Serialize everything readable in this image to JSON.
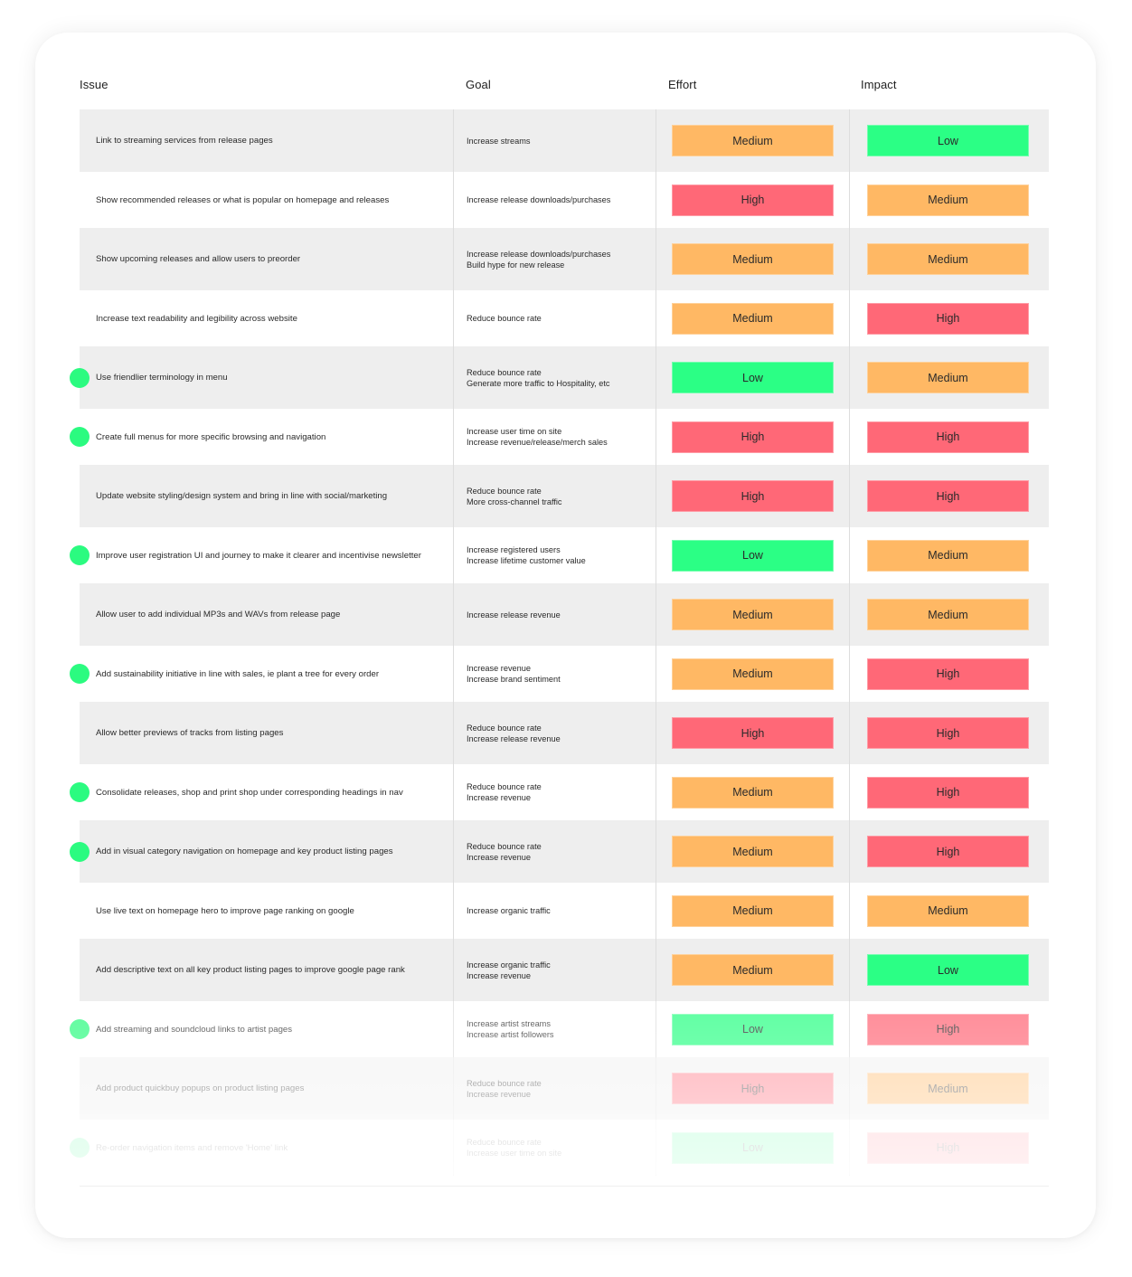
{
  "headers": {
    "issue": "Issue",
    "goal": "Goal",
    "effort": "Effort",
    "impact": "Impact"
  },
  "colors": {
    "Low": "#2bff85",
    "Medium": "#ffb864",
    "High": "#ff6877",
    "row_alt": "#eeeeee",
    "marker": "#2bfb80"
  },
  "rows": [
    {
      "issue": "Link to streaming services from release pages",
      "goal": [
        "Increase streams"
      ],
      "effort": "Medium",
      "impact": "Low",
      "marked": false
    },
    {
      "issue": "Show recommended releases or what is popular on homepage and releases",
      "goal": [
        "Increase release downloads/purchases"
      ],
      "effort": "High",
      "impact": "Medium",
      "marked": false
    },
    {
      "issue": "Show upcoming releases and allow users to preorder",
      "goal": [
        "Increase release downloads/purchases",
        "Build hype for new release"
      ],
      "effort": "Medium",
      "impact": "Medium",
      "marked": false
    },
    {
      "issue": "Increase text readability and legibility across website",
      "goal": [
        "Reduce bounce rate"
      ],
      "effort": "Medium",
      "impact": "High",
      "marked": false
    },
    {
      "issue": "Use friendlier terminology in menu",
      "goal": [
        "Reduce bounce rate",
        "Generate more traffic to Hospitality, etc"
      ],
      "effort": "Low",
      "impact": "Medium",
      "marked": true
    },
    {
      "issue": "Create full menus for more specific browsing and navigation",
      "goal": [
        "Increase user time on site",
        "Increase revenue/release/merch sales"
      ],
      "effort": "High",
      "impact": "High",
      "marked": true
    },
    {
      "issue": "Update website styling/design system and bring in line with social/marketing",
      "goal": [
        "Reduce bounce rate",
        "More cross-channel traffic"
      ],
      "effort": "High",
      "impact": "High",
      "marked": false
    },
    {
      "issue": "Improve user registration UI and journey to make it clearer and incentivise newsletter",
      "goal": [
        "Increase registered users",
        "Increase lifetime customer value"
      ],
      "effort": "Low",
      "impact": "Medium",
      "marked": true
    },
    {
      "issue": "Allow user to add individual MP3s and WAVs from release page",
      "goal": [
        "Increase release revenue"
      ],
      "effort": "Medium",
      "impact": "Medium",
      "marked": false
    },
    {
      "issue": "Add sustainability initiative in line with sales, ie plant a tree for every order",
      "goal": [
        "Increase revenue",
        "Increase brand sentiment"
      ],
      "effort": "Medium",
      "impact": "High",
      "marked": true
    },
    {
      "issue": "Allow better previews of tracks from listing pages",
      "goal": [
        "Reduce bounce rate",
        "Increase release revenue"
      ],
      "effort": "High",
      "impact": "High",
      "marked": false
    },
    {
      "issue": "Consolidate releases, shop and print shop under corresponding headings in nav",
      "goal": [
        "Reduce bounce rate",
        "Increase revenue"
      ],
      "effort": "Medium",
      "impact": "High",
      "marked": true
    },
    {
      "issue": "Add in visual category navigation on homepage and key product listing pages",
      "goal": [
        "Reduce bounce rate",
        "Increase revenue"
      ],
      "effort": "Medium",
      "impact": "High",
      "marked": true
    },
    {
      "issue": "Use live text on homepage hero to improve page ranking on google",
      "goal": [
        "Increase organic traffic"
      ],
      "effort": "Medium",
      "impact": "Medium",
      "marked": false
    },
    {
      "issue": "Add descriptive text on all key product listing pages to improve google page rank",
      "goal": [
        "Increase organic traffic",
        "Increase revenue"
      ],
      "effort": "Medium",
      "impact": "Low",
      "marked": false
    },
    {
      "issue": "Add streaming and soundcloud links to artist pages",
      "goal": [
        "Increase artist streams",
        "Increase artist followers"
      ],
      "effort": "Low",
      "impact": "High",
      "marked": true
    },
    {
      "issue": "Add product quickbuy popups on product listing pages",
      "goal": [
        "Reduce bounce rate",
        "Increase revenue"
      ],
      "effort": "High",
      "impact": "Medium",
      "marked": false
    },
    {
      "issue": "Re-order navigation items and remove 'Home' link",
      "goal": [
        "Reduce bounce rate",
        "Increase user time on site"
      ],
      "effort": "Low",
      "impact": "High",
      "marked": true
    }
  ]
}
